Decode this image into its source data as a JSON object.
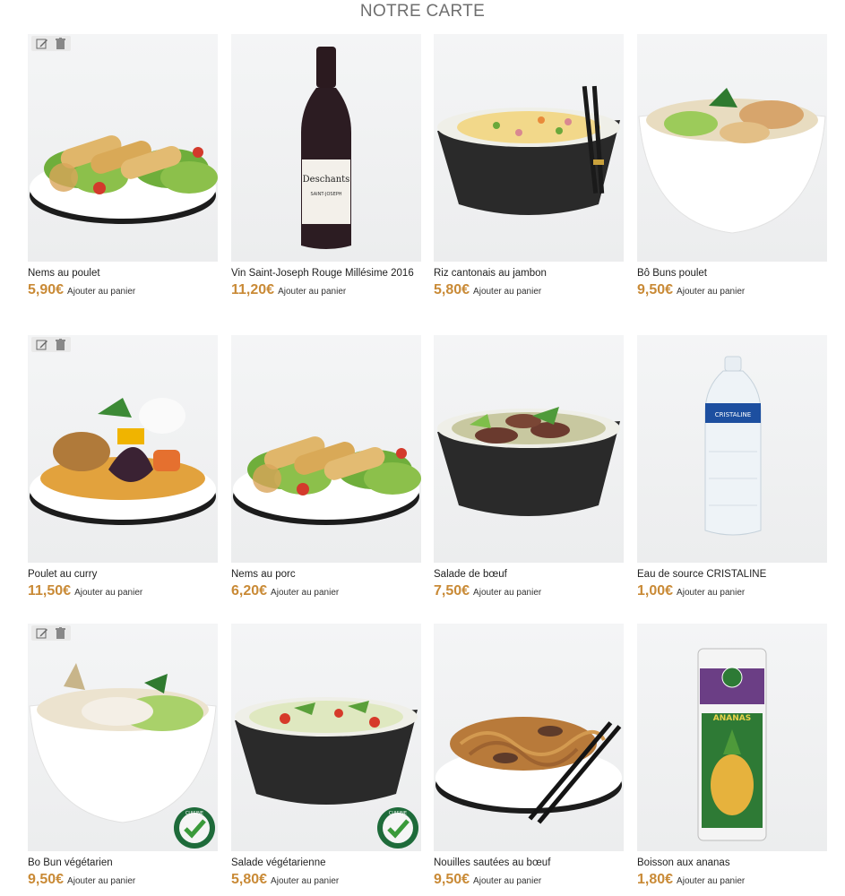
{
  "page": {
    "title": "NOTRE CARTE"
  },
  "icons": {
    "edit": "edit-icon",
    "delete": "trash-icon",
    "badge": "cuisine-vegetarienne-badge"
  },
  "colors": {
    "price": "#c98a36",
    "title": "#6f6f6f",
    "badge_green": "#1e6b3a"
  },
  "cart_label": "Ajouter au panier",
  "products": [
    {
      "name": "Nems au poulet",
      "price": "5,90€",
      "has_admin_tools": true,
      "vegetarian_badge": false,
      "kind": "nems"
    },
    {
      "name": "Vin Saint-Joseph Rouge Millésime 2016",
      "price": "11,20€",
      "has_admin_tools": false,
      "vegetarian_badge": false,
      "kind": "wine"
    },
    {
      "name": "Riz cantonais au jambon",
      "price": "5,80€",
      "has_admin_tools": false,
      "vegetarian_badge": false,
      "kind": "rice"
    },
    {
      "name": "Bô Buns poulet",
      "price": "9,50€",
      "has_admin_tools": false,
      "vegetarian_badge": false,
      "kind": "bobun"
    },
    {
      "name": "Poulet au curry",
      "price": "11,50€",
      "has_admin_tools": true,
      "vegetarian_badge": false,
      "kind": "curry"
    },
    {
      "name": "Nems au porc",
      "price": "6,20€",
      "has_admin_tools": false,
      "vegetarian_badge": false,
      "kind": "nems"
    },
    {
      "name": "Salade de bœuf",
      "price": "7,50€",
      "has_admin_tools": false,
      "vegetarian_badge": false,
      "kind": "salad_beef"
    },
    {
      "name": "Eau de source CRISTALINE",
      "price": "1,00€",
      "has_admin_tools": false,
      "vegetarian_badge": false,
      "kind": "water"
    },
    {
      "name": "Bo Bun végétarien",
      "price": "9,50€",
      "has_admin_tools": true,
      "vegetarian_badge": true,
      "kind": "bobun_veg"
    },
    {
      "name": "Salade végétarienne",
      "price": "5,80€",
      "has_admin_tools": false,
      "vegetarian_badge": true,
      "kind": "salad_veg"
    },
    {
      "name": "Nouilles sautées au bœuf",
      "price": "9,50€",
      "has_admin_tools": false,
      "vegetarian_badge": false,
      "kind": "noodles"
    },
    {
      "name": "Boisson aux ananas",
      "price": "1,80€",
      "has_admin_tools": false,
      "vegetarian_badge": false,
      "kind": "can"
    }
  ]
}
